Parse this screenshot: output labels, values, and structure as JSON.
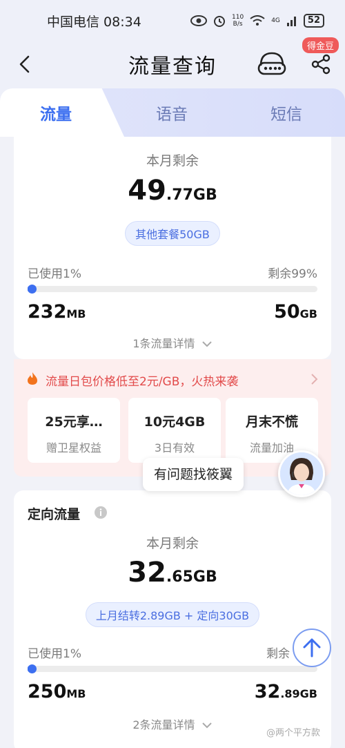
{
  "status": {
    "carrier_time": "中国电信 08:34",
    "speed": "110",
    "speed_unit": "B/s",
    "network": "4G",
    "battery": "52"
  },
  "nav": {
    "title": "流量查询",
    "badge": "得金豆"
  },
  "tabs": [
    "流量",
    "语音",
    "短信"
  ],
  "main_card": {
    "label": "本月剩余",
    "remaining_int": "49",
    "remaining_dec": ".77GB",
    "package": "其他套餐50GB",
    "used_label": "已使用1%",
    "remain_label": "剩余99%",
    "used_percent": 1,
    "used_value": "232",
    "used_unit": "MB",
    "total_value": "50",
    "total_unit": "GB",
    "details": "1条流量详情"
  },
  "promo": {
    "headline": "流量日包价格低至2元/GB，火热来袭",
    "items": [
      {
        "title": "25元享…",
        "sub": "赠卫星权益"
      },
      {
        "title": "10元4GB",
        "sub": "3日有效"
      },
      {
        "title": "月末不慌",
        "sub": "流量加油"
      }
    ]
  },
  "assistant": {
    "bubble": "有问题找筱翼"
  },
  "directed_card": {
    "title": "定向流量",
    "label": "本月剩余",
    "remaining_int": "32",
    "remaining_dec": ".65GB",
    "package": "上月结转2.89GB + 定向30GB",
    "used_label": "已使用1%",
    "remain_label": "剩余",
    "used_percent": 1,
    "used_value": "250",
    "used_unit": "MB",
    "total_value": "32",
    "total_unit": ".89GB",
    "details": "2条流量详情"
  },
  "watermark": "@两个平方款"
}
